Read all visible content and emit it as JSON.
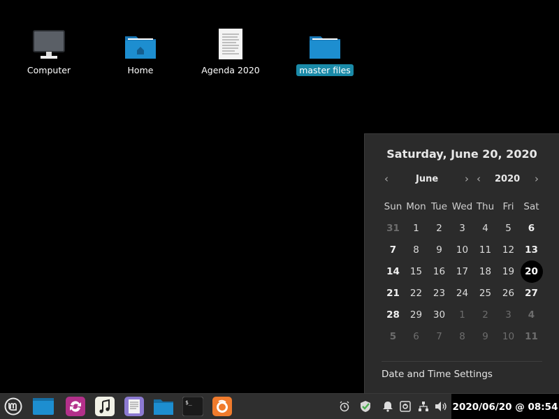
{
  "desktop": {
    "icons": [
      {
        "label": "Computer"
      },
      {
        "label": "Home"
      },
      {
        "label": "Agenda 2020"
      },
      {
        "label": "master files"
      }
    ]
  },
  "calendar": {
    "title": "Saturday, June 20, 2020",
    "month": "June",
    "year": "2020",
    "prev_symbol": "‹",
    "next_symbol": "›",
    "weekdays": [
      "Sun",
      "Mon",
      "Tue",
      "Wed",
      "Thu",
      "Fri",
      "Sat"
    ],
    "weeks": [
      [
        "31",
        "1",
        "2",
        "3",
        "4",
        "5",
        "6"
      ],
      [
        "7",
        "8",
        "9",
        "10",
        "11",
        "12",
        "13"
      ],
      [
        "14",
        "15",
        "16",
        "17",
        "18",
        "19",
        "20"
      ],
      [
        "21",
        "22",
        "23",
        "24",
        "25",
        "26",
        "27"
      ],
      [
        "28",
        "29",
        "30",
        "1",
        "2",
        "3",
        "4"
      ],
      [
        "5",
        "6",
        "7",
        "8",
        "9",
        "10",
        "11"
      ]
    ],
    "settings_label": "Date and Time Settings"
  },
  "taskbar": {
    "clock": "2020/06/20 @ 08:54",
    "launchers": [
      "menu-icon",
      "show-desktop-icon",
      "software-updater-icon",
      "music-player-icon",
      "text-editor-icon",
      "files-icon",
      "terminal-icon",
      "firefox-icon"
    ],
    "tray": [
      "alarm-icon",
      "shield-check-icon",
      "notification-bell-icon",
      "update-manager-icon",
      "network-icon",
      "volume-icon"
    ]
  },
  "colors": {
    "selection": "#1a8aa8",
    "folder": "#1d8ed0",
    "panel": "#2f2f2f",
    "popup": "#2b2b2b"
  }
}
